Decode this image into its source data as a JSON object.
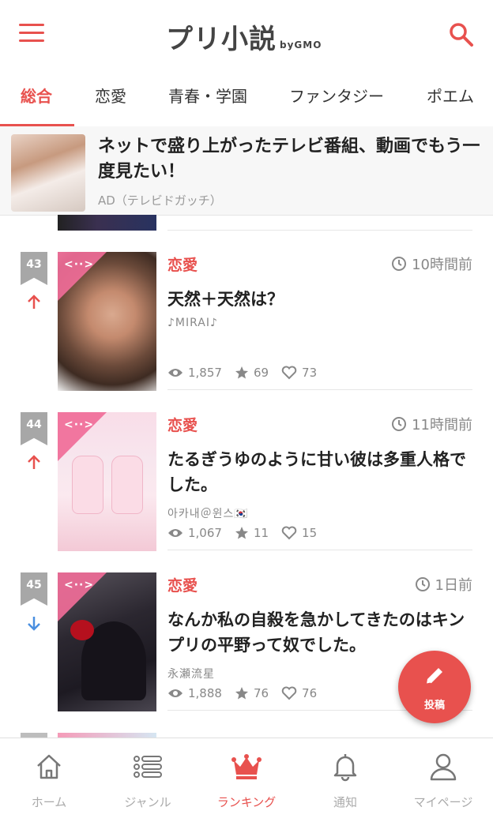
{
  "header": {
    "logo_text": "プリ小説",
    "logo_sub": "byGMO",
    "menu_icon": "hamburger-menu-icon",
    "search_icon": "search-icon"
  },
  "tabs": [
    {
      "label": "総合",
      "active": true
    },
    {
      "label": "恋愛",
      "active": false
    },
    {
      "label": "青春・学園",
      "active": false
    },
    {
      "label": "ファンタジー",
      "active": false
    },
    {
      "label": "ポエム",
      "active": false
    }
  ],
  "ad": {
    "title": "ネットで盛り上がったテレビ番組、動画でもう一度見たい！",
    "label": "AD（テレビドガッチ）"
  },
  "items": [
    {
      "rank": "43",
      "trend": "up",
      "genre": "恋愛",
      "time": "10時間前",
      "title": "天然＋天然は？",
      "author": "♪MIRAI♪",
      "views": "1,857",
      "stars": "69",
      "likes": "73"
    },
    {
      "rank": "44",
      "trend": "up",
      "genre": "恋愛",
      "time": "11時間前",
      "title": "たるぎうゆのように甘い彼は多重人格でした。",
      "author": "아카내＠윈스🇰🇷",
      "views": "1,067",
      "stars": "11",
      "likes": "15"
    },
    {
      "rank": "45",
      "trend": "down",
      "genre": "恋愛",
      "time": "1日前",
      "title": "なんか私の自殺を急かしてきたのはキンプリの平野って奴でした。",
      "author": "永瀬流星",
      "views": "1,888",
      "stars": "76",
      "likes": "76"
    }
  ],
  "fab": {
    "label": "投稿",
    "icon": "pencil-icon"
  },
  "bottom_nav": [
    {
      "label": "ホーム",
      "icon": "home-icon",
      "active": false
    },
    {
      "label": "ジャンル",
      "icon": "list-icon",
      "active": false
    },
    {
      "label": "ランキング",
      "icon": "crown-icon",
      "active": true
    },
    {
      "label": "通知",
      "icon": "bell-icon",
      "active": false
    },
    {
      "label": "マイページ",
      "icon": "user-icon",
      "active": false
    }
  ],
  "colors": {
    "accent": "#e8514e",
    "trend_up": "#e8514e",
    "trend_down": "#4a8fe0",
    "rank_badge": "#a7a7a7"
  }
}
